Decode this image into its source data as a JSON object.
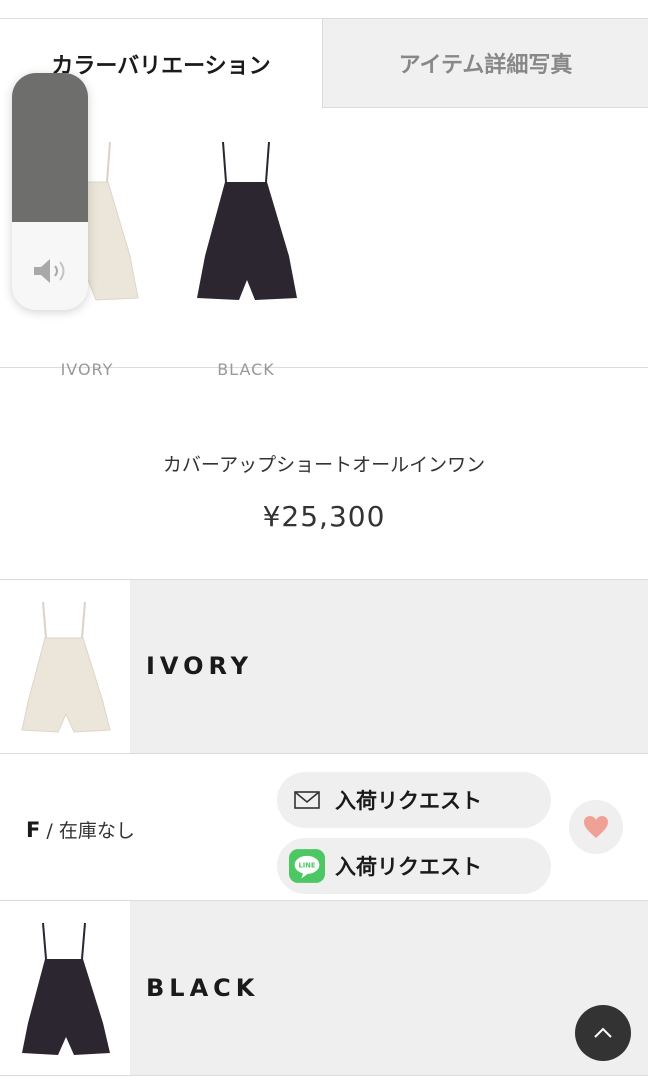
{
  "tabs": {
    "color_variation": "カラーバリエーション",
    "item_photos": "アイテム詳細写真"
  },
  "variations": [
    {
      "label": "IVORY",
      "color": "#ece6da"
    },
    {
      "label": "BLACK",
      "color": "#2c2630"
    }
  ],
  "volume_hud": {
    "level_percent": 37,
    "icon": "speaker-icon"
  },
  "product": {
    "name": "カバーアップショートオールインワン",
    "price": "¥25,300"
  },
  "colors": [
    {
      "name": "IVORY",
      "swatch": "#ece6da",
      "sizes": [
        {
          "size": "F",
          "separator": "/",
          "stock": "在庫なし",
          "mail_request": "入荷リクエスト",
          "line_request": "入荷リクエスト",
          "line_badge": "LINE"
        }
      ]
    },
    {
      "name": "BLACK",
      "swatch": "#2c2630"
    }
  ],
  "theme": {
    "accent_heart": "#f0a196",
    "line_green": "#4cc764",
    "dark_button": "#333333"
  },
  "icons": {
    "mail": "mail-icon",
    "line": "line-icon",
    "favorite": "heart-icon",
    "back_to_top": "chevron-up-icon"
  }
}
